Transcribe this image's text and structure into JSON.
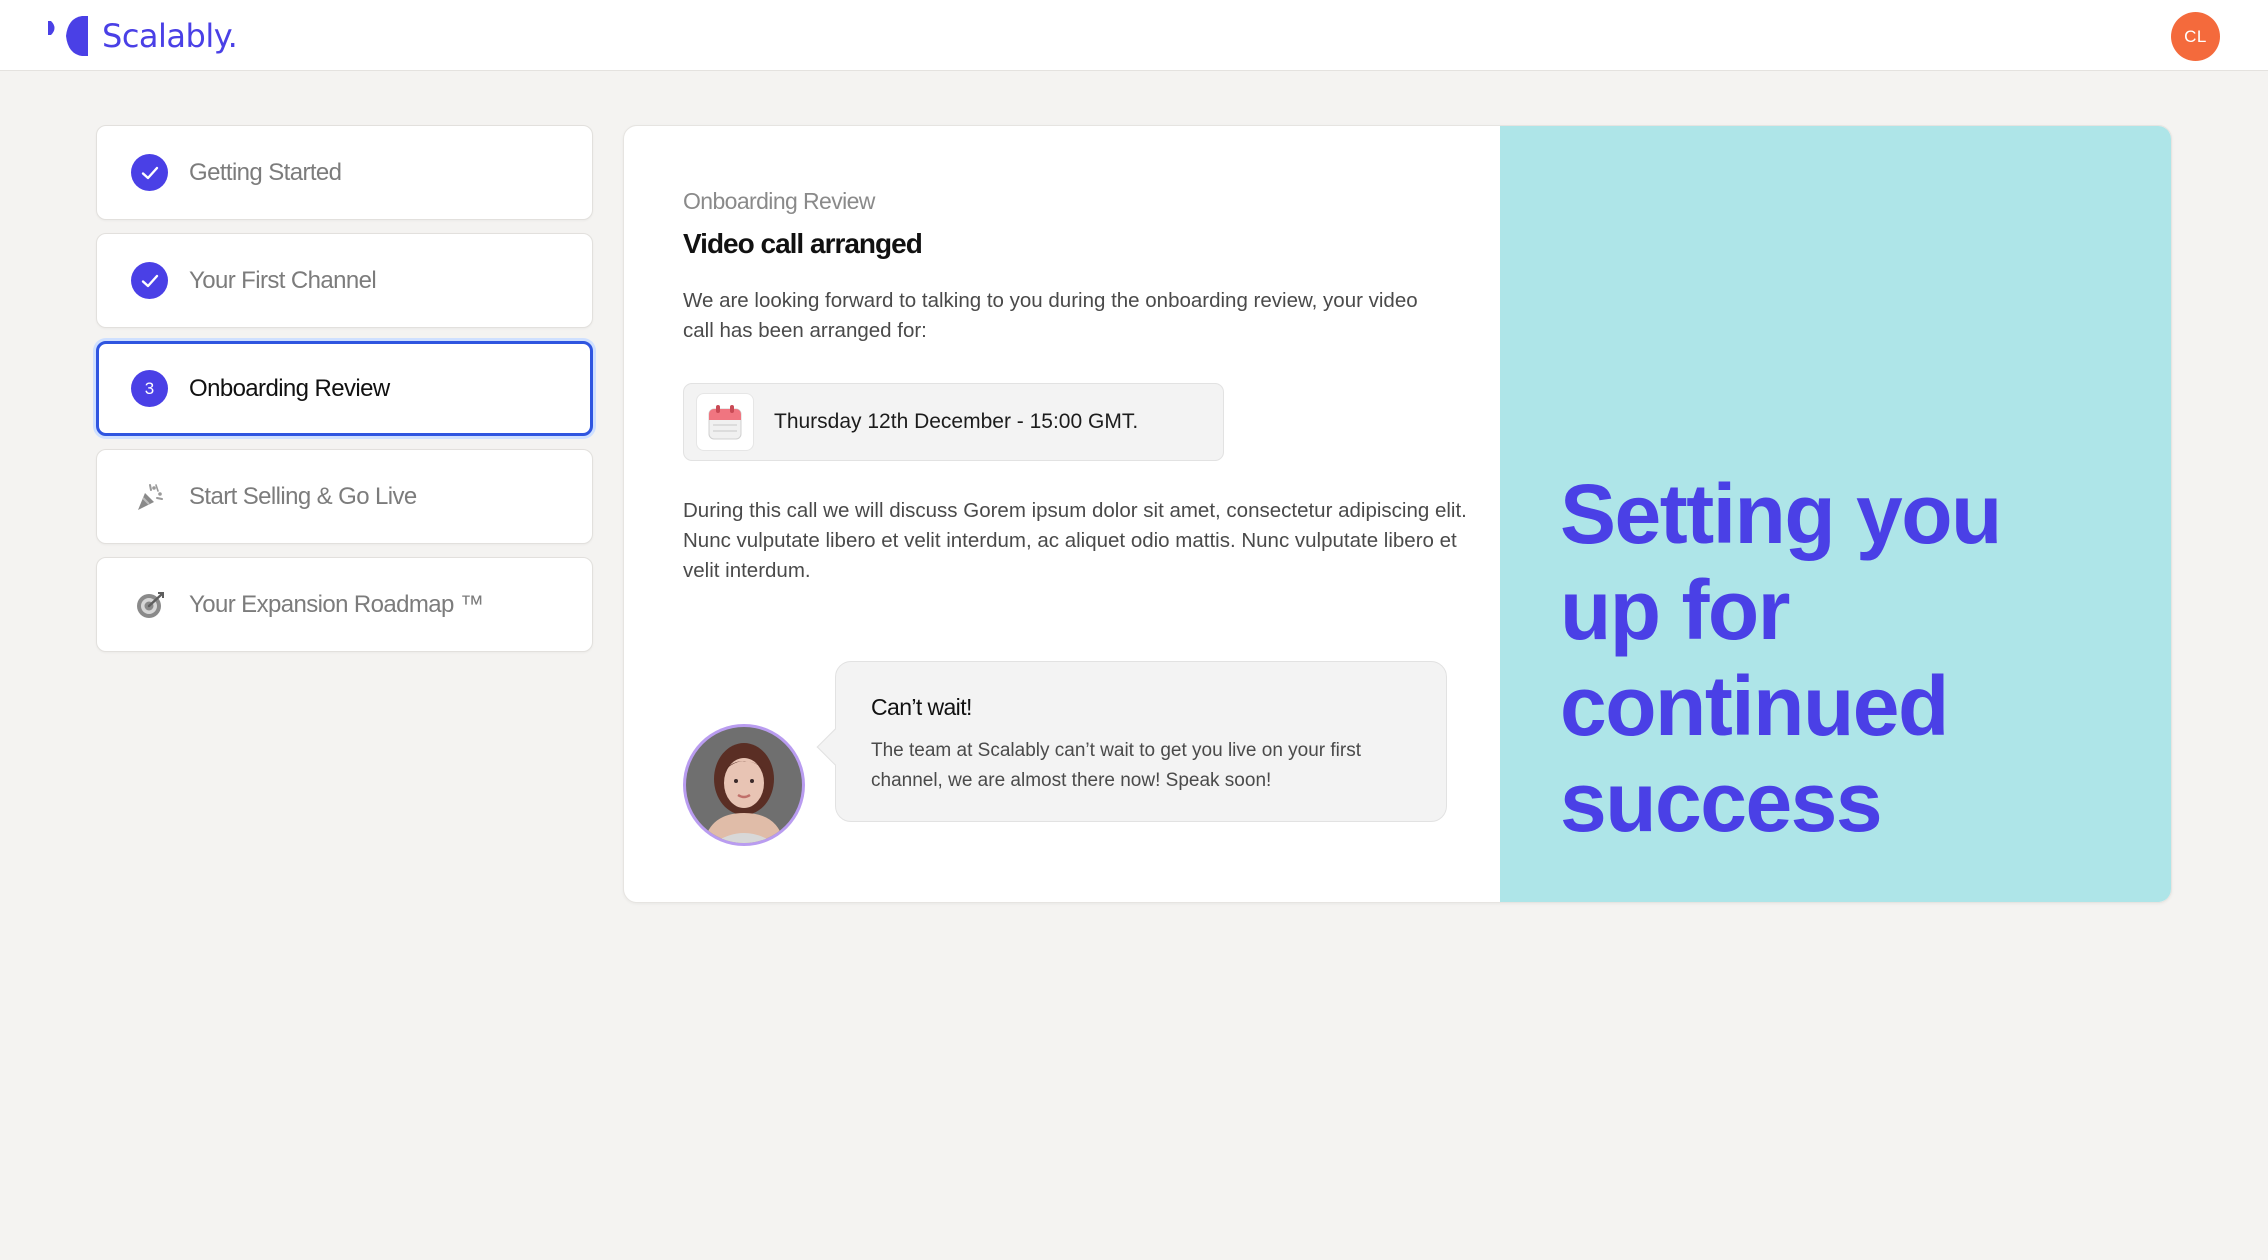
{
  "brand": {
    "name": "Scalably.",
    "accent": "#4a40e6"
  },
  "user": {
    "initials": "CL",
    "avatar_color": "#f46a3c"
  },
  "steps": [
    {
      "label": "Getting Started",
      "state": "complete",
      "icon": "check-icon"
    },
    {
      "label": "Your First Channel",
      "state": "complete",
      "icon": "check-icon"
    },
    {
      "label": "Onboarding Review",
      "state": "active",
      "number": "3"
    },
    {
      "label": "Start Selling & Go Live",
      "state": "upcoming",
      "icon": "party-popper-icon"
    },
    {
      "label": "Your Expansion Roadmap ™",
      "state": "upcoming",
      "icon": "target-icon"
    }
  ],
  "main": {
    "eyebrow": "Onboarding Review",
    "title": "Video call arranged",
    "intro": "We are looking forward to talking to you during the onboarding review, your video call has been arranged for:",
    "date": "Thursday 12th December - 15:00 GMT.",
    "body": "During this call we will discuss Gorem ipsum dolor sit amet, consectetur adipiscing elit. Nunc vulputate libero et velit interdum, ac aliquet odio mattis. Nunc vulputate libero et velit interdum.",
    "message": {
      "title": "Can’t wait!",
      "text": "The team at Scalably can’t wait to get you live on your first channel, we are almost there now! Speak soon!"
    }
  },
  "hero": {
    "text": "Setting you up for continued success",
    "background": "#aee5e8"
  }
}
